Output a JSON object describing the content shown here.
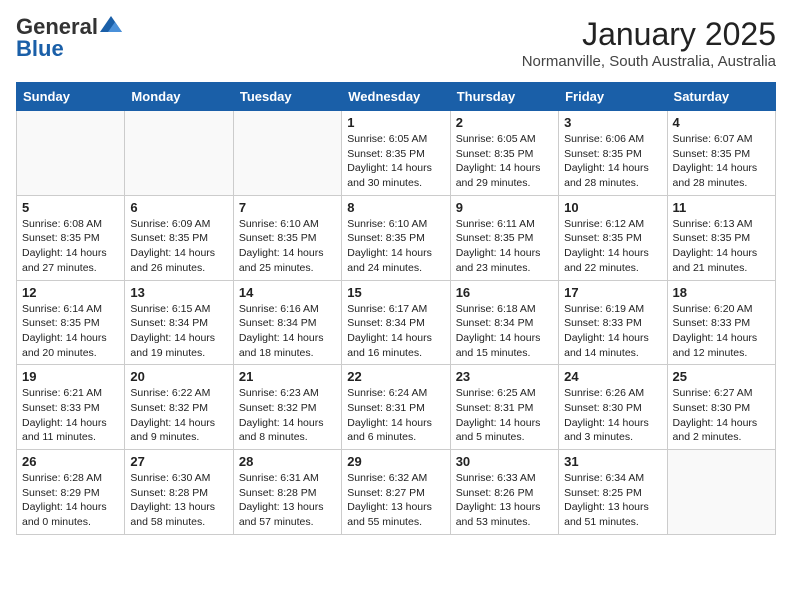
{
  "logo": {
    "general": "General",
    "blue": "Blue"
  },
  "title": "January 2025",
  "location": "Normanville, South Australia, Australia",
  "weekdays": [
    "Sunday",
    "Monday",
    "Tuesday",
    "Wednesday",
    "Thursday",
    "Friday",
    "Saturday"
  ],
  "weeks": [
    [
      {
        "day": "",
        "info": ""
      },
      {
        "day": "",
        "info": ""
      },
      {
        "day": "",
        "info": ""
      },
      {
        "day": "1",
        "info": "Sunrise: 6:05 AM\nSunset: 8:35 PM\nDaylight: 14 hours\nand 30 minutes."
      },
      {
        "day": "2",
        "info": "Sunrise: 6:05 AM\nSunset: 8:35 PM\nDaylight: 14 hours\nand 29 minutes."
      },
      {
        "day": "3",
        "info": "Sunrise: 6:06 AM\nSunset: 8:35 PM\nDaylight: 14 hours\nand 28 minutes."
      },
      {
        "day": "4",
        "info": "Sunrise: 6:07 AM\nSunset: 8:35 PM\nDaylight: 14 hours\nand 28 minutes."
      }
    ],
    [
      {
        "day": "5",
        "info": "Sunrise: 6:08 AM\nSunset: 8:35 PM\nDaylight: 14 hours\nand 27 minutes."
      },
      {
        "day": "6",
        "info": "Sunrise: 6:09 AM\nSunset: 8:35 PM\nDaylight: 14 hours\nand 26 minutes."
      },
      {
        "day": "7",
        "info": "Sunrise: 6:10 AM\nSunset: 8:35 PM\nDaylight: 14 hours\nand 25 minutes."
      },
      {
        "day": "8",
        "info": "Sunrise: 6:10 AM\nSunset: 8:35 PM\nDaylight: 14 hours\nand 24 minutes."
      },
      {
        "day": "9",
        "info": "Sunrise: 6:11 AM\nSunset: 8:35 PM\nDaylight: 14 hours\nand 23 minutes."
      },
      {
        "day": "10",
        "info": "Sunrise: 6:12 AM\nSunset: 8:35 PM\nDaylight: 14 hours\nand 22 minutes."
      },
      {
        "day": "11",
        "info": "Sunrise: 6:13 AM\nSunset: 8:35 PM\nDaylight: 14 hours\nand 21 minutes."
      }
    ],
    [
      {
        "day": "12",
        "info": "Sunrise: 6:14 AM\nSunset: 8:35 PM\nDaylight: 14 hours\nand 20 minutes."
      },
      {
        "day": "13",
        "info": "Sunrise: 6:15 AM\nSunset: 8:34 PM\nDaylight: 14 hours\nand 19 minutes."
      },
      {
        "day": "14",
        "info": "Sunrise: 6:16 AM\nSunset: 8:34 PM\nDaylight: 14 hours\nand 18 minutes."
      },
      {
        "day": "15",
        "info": "Sunrise: 6:17 AM\nSunset: 8:34 PM\nDaylight: 14 hours\nand 16 minutes."
      },
      {
        "day": "16",
        "info": "Sunrise: 6:18 AM\nSunset: 8:34 PM\nDaylight: 14 hours\nand 15 minutes."
      },
      {
        "day": "17",
        "info": "Sunrise: 6:19 AM\nSunset: 8:33 PM\nDaylight: 14 hours\nand 14 minutes."
      },
      {
        "day": "18",
        "info": "Sunrise: 6:20 AM\nSunset: 8:33 PM\nDaylight: 14 hours\nand 12 minutes."
      }
    ],
    [
      {
        "day": "19",
        "info": "Sunrise: 6:21 AM\nSunset: 8:33 PM\nDaylight: 14 hours\nand 11 minutes."
      },
      {
        "day": "20",
        "info": "Sunrise: 6:22 AM\nSunset: 8:32 PM\nDaylight: 14 hours\nand 9 minutes."
      },
      {
        "day": "21",
        "info": "Sunrise: 6:23 AM\nSunset: 8:32 PM\nDaylight: 14 hours\nand 8 minutes."
      },
      {
        "day": "22",
        "info": "Sunrise: 6:24 AM\nSunset: 8:31 PM\nDaylight: 14 hours\nand 6 minutes."
      },
      {
        "day": "23",
        "info": "Sunrise: 6:25 AM\nSunset: 8:31 PM\nDaylight: 14 hours\nand 5 minutes."
      },
      {
        "day": "24",
        "info": "Sunrise: 6:26 AM\nSunset: 8:30 PM\nDaylight: 14 hours\nand 3 minutes."
      },
      {
        "day": "25",
        "info": "Sunrise: 6:27 AM\nSunset: 8:30 PM\nDaylight: 14 hours\nand 2 minutes."
      }
    ],
    [
      {
        "day": "26",
        "info": "Sunrise: 6:28 AM\nSunset: 8:29 PM\nDaylight: 14 hours\nand 0 minutes."
      },
      {
        "day": "27",
        "info": "Sunrise: 6:30 AM\nSunset: 8:28 PM\nDaylight: 13 hours\nand 58 minutes."
      },
      {
        "day": "28",
        "info": "Sunrise: 6:31 AM\nSunset: 8:28 PM\nDaylight: 13 hours\nand 57 minutes."
      },
      {
        "day": "29",
        "info": "Sunrise: 6:32 AM\nSunset: 8:27 PM\nDaylight: 13 hours\nand 55 minutes."
      },
      {
        "day": "30",
        "info": "Sunrise: 6:33 AM\nSunset: 8:26 PM\nDaylight: 13 hours\nand 53 minutes."
      },
      {
        "day": "31",
        "info": "Sunrise: 6:34 AM\nSunset: 8:25 PM\nDaylight: 13 hours\nand 51 minutes."
      },
      {
        "day": "",
        "info": ""
      }
    ]
  ]
}
